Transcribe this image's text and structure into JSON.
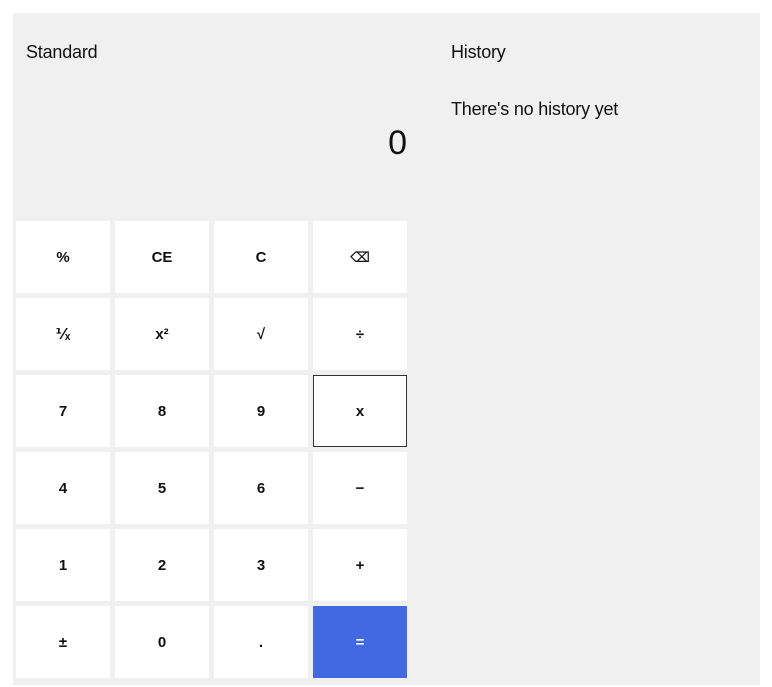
{
  "calculator": {
    "mode": "Standard",
    "display_value": "0",
    "accent_color": "#4169e1",
    "keys": [
      {
        "id": "percent",
        "label": "%"
      },
      {
        "id": "clear-entry",
        "label": "CE"
      },
      {
        "id": "clear",
        "label": "C"
      },
      {
        "id": "backspace",
        "label": "⌫",
        "icon": "backspace-icon"
      },
      {
        "id": "reciprocal",
        "label": "⅟ₓ"
      },
      {
        "id": "square",
        "label": "x²"
      },
      {
        "id": "square-root",
        "label": "√"
      },
      {
        "id": "divide",
        "label": "÷"
      },
      {
        "id": "digit-7",
        "label": "7"
      },
      {
        "id": "digit-8",
        "label": "8"
      },
      {
        "id": "digit-9",
        "label": "9"
      },
      {
        "id": "multiply",
        "label": "x"
      },
      {
        "id": "digit-4",
        "label": "4"
      },
      {
        "id": "digit-5",
        "label": "5"
      },
      {
        "id": "digit-6",
        "label": "6"
      },
      {
        "id": "subtract",
        "label": "−"
      },
      {
        "id": "digit-1",
        "label": "1"
      },
      {
        "id": "digit-2",
        "label": "2"
      },
      {
        "id": "digit-3",
        "label": "3"
      },
      {
        "id": "add",
        "label": "+"
      },
      {
        "id": "negate",
        "label": "±"
      },
      {
        "id": "digit-0",
        "label": "0"
      },
      {
        "id": "decimal",
        "label": "."
      },
      {
        "id": "equals",
        "label": "="
      }
    ]
  },
  "history": {
    "title": "History",
    "empty_message": "There's no history yet"
  }
}
